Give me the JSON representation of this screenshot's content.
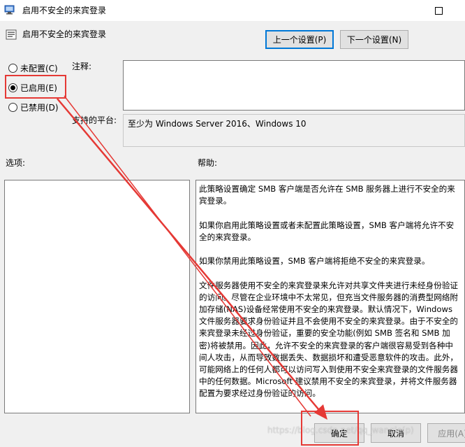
{
  "window": {
    "title": "启用不安全的来宾登录"
  },
  "header": {
    "title": "启用不安全的来宾登录",
    "prev_button": "上一个设置(P)",
    "next_button": "下一个设置(N)"
  },
  "state": {
    "options": [
      {
        "label": "未配置(C)",
        "selected": false
      },
      {
        "label": "已启用(E)",
        "selected": true
      },
      {
        "label": "已禁用(D)",
        "selected": false
      }
    ]
  },
  "comment": {
    "label": "注释:",
    "value": ""
  },
  "platform": {
    "label": "支持的平台:",
    "value": "至少为 Windows Server 2016、Windows 10"
  },
  "options_panel": {
    "label": "选项:"
  },
  "help": {
    "label": "帮助:",
    "lines": [
      "此策略设置确定 SMB 客户端是否允许在 SMB 服务器上进行不安全的来",
      "宾登录。",
      "",
      "如果你启用此策略设置或者未配置此策略设置，SMB 客户端将允许不安",
      "全的来宾登录。",
      "",
      "如果你禁用此策略设置，SMB 客户端将拒绝不安全的来宾登录。",
      "",
      "文件服务器使用不安全的来宾登录来允许对共享文件夹进行未经身份验证",
      "的访问。尽管在企业环境中不太常见，但充当文件服务器的消费型网络附",
      "加存储(NAS)设备经常使用不安全的来宾登录。默认情况下，Windows",
      "文件服务器要求身份验证并且不会使用不安全的来宾登录。由于不安全的",
      "来宾登录未经过身份验证，重要的安全功能(例如 SMB 签名和 SMB 加",
      "密)将被禁用。因此，允许不安全的来宾登录的客户端很容易受到各种中",
      "间人攻击，从而导致数据丢失、数据损坏和遭受恶意软件的攻击。此外，",
      "可能网络上的任何人都可以访问写入到使用不安全来宾登录的文件服务器",
      "中的任何数据。Microsoft 建议禁用不安全的来宾登录，并将文件服务器",
      "配置为要求经过身份验证的访问。"
    ]
  },
  "footer": {
    "ok_button": "确定",
    "cancel_button": "取消",
    "apply_button": "应用(A)"
  },
  "watermark": "https://blog.csdn.net/qq_wangle(p)"
}
